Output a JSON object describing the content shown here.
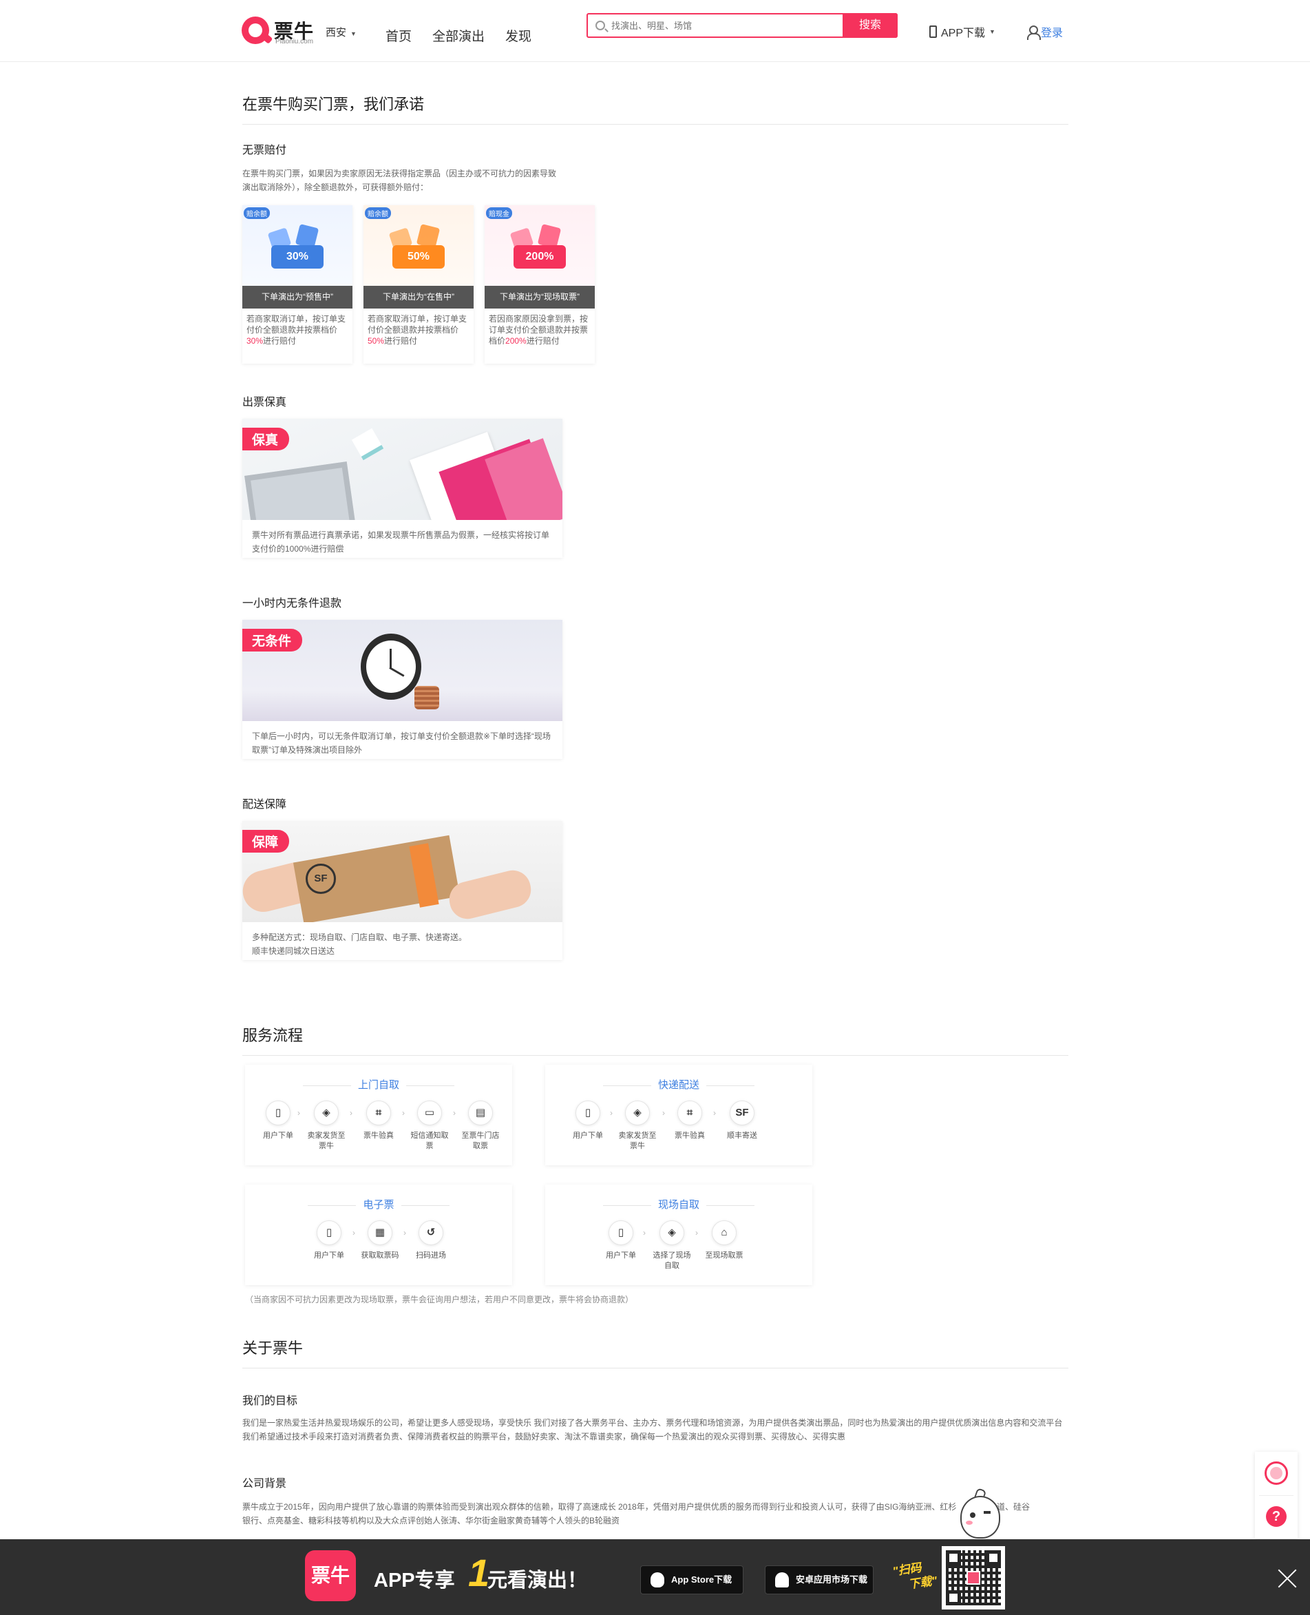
{
  "header": {
    "logo_text": "票牛",
    "logo_sub": "Piaoniu.com",
    "city": "西安",
    "nav": [
      "首页",
      "全部演出",
      "发现"
    ],
    "search_placeholder": "找演出、明星、场馆",
    "search_button": "搜索",
    "app_download": "APP下载",
    "login": "登录"
  },
  "promise": {
    "title": "在票牛购买门票，我们承诺",
    "no_ticket": {
      "title": "无票赔付",
      "desc_line1": "在票牛购买门票，如果因为卖家原因无法获得指定票品（因主办或不可抗力的因素导致",
      "desc_line2": "演出取消除外），除全额退款外，可获得额外赔付：",
      "cards": [
        {
          "badge": "赔余额",
          "percent": "30%",
          "bar": "下单演出为“预售中”",
          "desc_pre": "若商家取消订单，按订单支付价全额退款并按票档价",
          "highlight": "30%",
          "desc_post": "进行赔付",
          "accent": "#3e7fe0"
        },
        {
          "badge": "赔余额",
          "percent": "50%",
          "bar": "下单演出为“在售中”",
          "desc_pre": "若商家取消订单，按订单支付价全额退款并按票档价",
          "highlight": "50%",
          "desc_post": "进行赔付",
          "accent": "#ff8a1f"
        },
        {
          "badge": "赔现金",
          "percent": "200%",
          "bar": "下单演出为“现场取票”",
          "desc_pre": "若因商家原因没拿到票，按订单支付价全额退款并按票档价",
          "highlight": "200%",
          "desc_post": "进行赔付",
          "accent": "#f5325c"
        }
      ]
    },
    "genuine": {
      "title": "出票保真",
      "tag": "保真",
      "desc": "票牛对所有票品进行真票承诺，如果发现票牛所售票品为假票，一经核实将按订单支付价的1000%进行赔偿"
    },
    "refund": {
      "title": "一小时内无条件退款",
      "tag": "无条件",
      "desc": "下单后一小时内，可以无条件取消订单，按订单支付价全额退款※下单时选择“现场取票”订单及特殊演出项目除外"
    },
    "delivery": {
      "title": "配送保障",
      "tag": "保障",
      "desc_line1": "多种配送方式：现场自取、门店自取、电子票、快递寄送。",
      "desc_line2": "顺丰快递同城次日送达"
    }
  },
  "service": {
    "title": "服务流程",
    "flows": [
      {
        "name": "上门自取",
        "steps": [
          {
            "icon": "phone-order-icon",
            "glyph": "▯",
            "label": "用户下单"
          },
          {
            "icon": "box-icon",
            "glyph": "◈",
            "label": "卖家发货至票牛"
          },
          {
            "icon": "scan-icon",
            "glyph": "⌗",
            "label": "票牛验真"
          },
          {
            "icon": "sms-icon",
            "glyph": "▭",
            "label": "短信通知取票"
          },
          {
            "icon": "store-icon",
            "glyph": "▤",
            "label": "至票牛门店取票"
          }
        ]
      },
      {
        "name": "快递配送",
        "steps": [
          {
            "icon": "phone-order-icon",
            "glyph": "▯",
            "label": "用户下单"
          },
          {
            "icon": "box-icon",
            "glyph": "◈",
            "label": "卖家发货至票牛"
          },
          {
            "icon": "scan-icon",
            "glyph": "⌗",
            "label": "票牛验真"
          },
          {
            "icon": "sf-icon",
            "glyph": "SF",
            "label": "顺丰寄送"
          }
        ]
      },
      {
        "name": "电子票",
        "steps": [
          {
            "icon": "phone-order-icon",
            "glyph": "▯",
            "label": "用户下单"
          },
          {
            "icon": "qrcode-icon",
            "glyph": "▦",
            "label": "获取取票码"
          },
          {
            "icon": "scan-enter-icon",
            "glyph": "↺",
            "label": "扫码进场"
          }
        ]
      },
      {
        "name": "现场自取",
        "steps": [
          {
            "icon": "phone-order-icon",
            "glyph": "▯",
            "label": "用户下单"
          },
          {
            "icon": "box-icon",
            "glyph": "◈",
            "label": "选择了现场自取"
          },
          {
            "icon": "venue-icon",
            "glyph": "⌂",
            "label": "至现场取票"
          }
        ]
      }
    ],
    "note": "（当商家因不可抗力因素更改为现场取票，票牛会征询用户想法，若用户不同意更改，票牛将会协商退款）"
  },
  "about": {
    "title": "关于票牛",
    "goal_title": "我们的目标",
    "goal_line1": "我们是一家热爱生活并热爱现场娱乐的公司，希望让更多人感受现场，享受快乐 我们对接了各大票务平台、主办方、票务代理和场馆资源，为用户提供各类演出票品，同时也为热爱演出的用户提供优质演出信息内容和交流平台",
    "goal_line2": "我们希望通过技术手段来打造对消费者负责、保障消费者权益的购票平台，鼓励好卖家、淘汰不靠谱卖家，确保每一个热爱演出的观众买得到票、买得放心、买得实惠",
    "bg_title": "公司背景",
    "bg_line1": "票牛成立于2015年，因向用户提供了放心靠谱的购票体验而受到演出观众群体的信赖，取得了高速成长 2018年，凭借对用户提供优质的服务而得到行业和投资人认可，获得了由SIG海纳亚洲、红杉",
    "bg_line1_tail": "头头是道、硅谷",
    "bg_line2": "银行、点亮基金、糖彩科技等机构以及大众点评创始人张涛、华尔街金融家黄奇辅等个人领头的B轮融资"
  },
  "banner": {
    "logo": "票牛",
    "app": "APP专享",
    "big_number": "1",
    "rest": "元看演出！",
    "app_store": "App Store下载",
    "android": "安卓应用市场下载",
    "scan_line1": "\"扫码",
    "scan_line2": "下载\""
  },
  "colors": {
    "brand": "#f5325c",
    "link": "#3e7fe0",
    "banner_bg": "#2f2f2f",
    "banner_accent": "#ffd22e"
  }
}
